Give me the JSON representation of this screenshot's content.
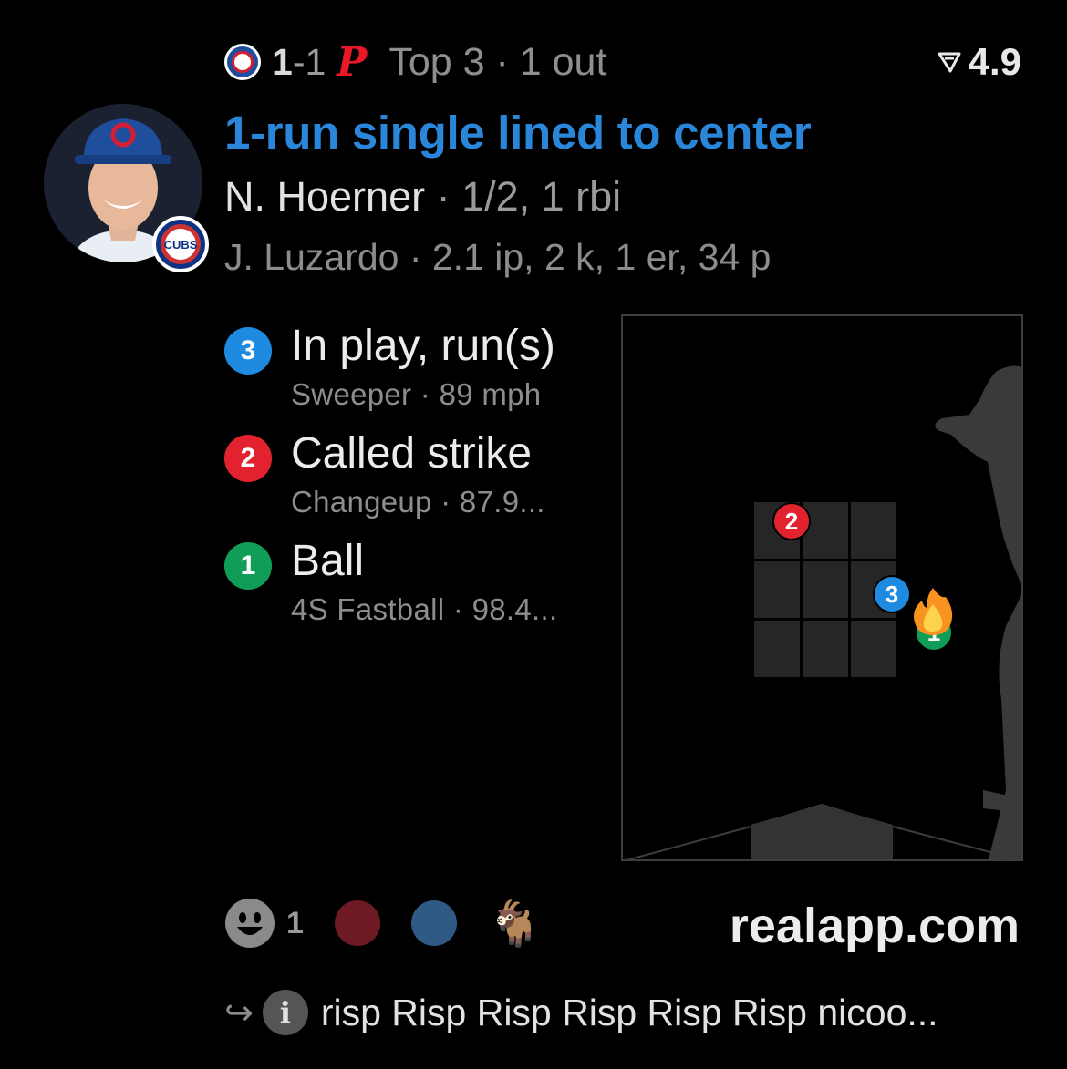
{
  "header": {
    "away_score": "1",
    "home_score": "-1",
    "phi_logo": "P",
    "inning_status": "Top 3 · 1 out",
    "rating": "4.9"
  },
  "play": {
    "title": "1-run single lined to center",
    "batter_name": "N. Hoerner",
    "batter_stats": " · 1/2, 1 rbi",
    "pitcher_line": "J. Luzardo · 2.1 ip, 2 k, 1 er, 34 p",
    "badge_text": "CUBS"
  },
  "pitches": [
    {
      "number": "3",
      "result": "In play, run(s)",
      "detail": "Sweeper ·  89 mph",
      "color": "#1f8be0"
    },
    {
      "number": "2",
      "result": "Called strike",
      "detail": "Changeup ·  87.9...",
      "color": "#e2232f"
    },
    {
      "number": "1",
      "result": "Ball",
      "detail": "4S Fastball ·  98.4...",
      "color": "#0f9d58"
    }
  ],
  "zone_markers": [
    {
      "number": "2",
      "color": "#e2232f"
    },
    {
      "number": "3",
      "color": "#1f8be0"
    },
    {
      "number": "1",
      "color": "#0f9d58"
    }
  ],
  "reactions": {
    "smiley_count": "1",
    "dot_colors": [
      "#6e1a24",
      "#2f5a86"
    ],
    "goat": "🐐"
  },
  "brand": "realapp.com",
  "footer": {
    "info_label": "i",
    "comment": "risp Risp Risp Risp Risp Risp nicoo..."
  },
  "colors": {
    "title_blue": "#2a86d8",
    "background": "#000000"
  },
  "icons": [
    "cubs-logo-icon",
    "phillies-logo-icon",
    "rating-icon",
    "smiley-icon",
    "goat-icon",
    "reply-arrow-icon",
    "info-icon",
    "fire-icon"
  ]
}
